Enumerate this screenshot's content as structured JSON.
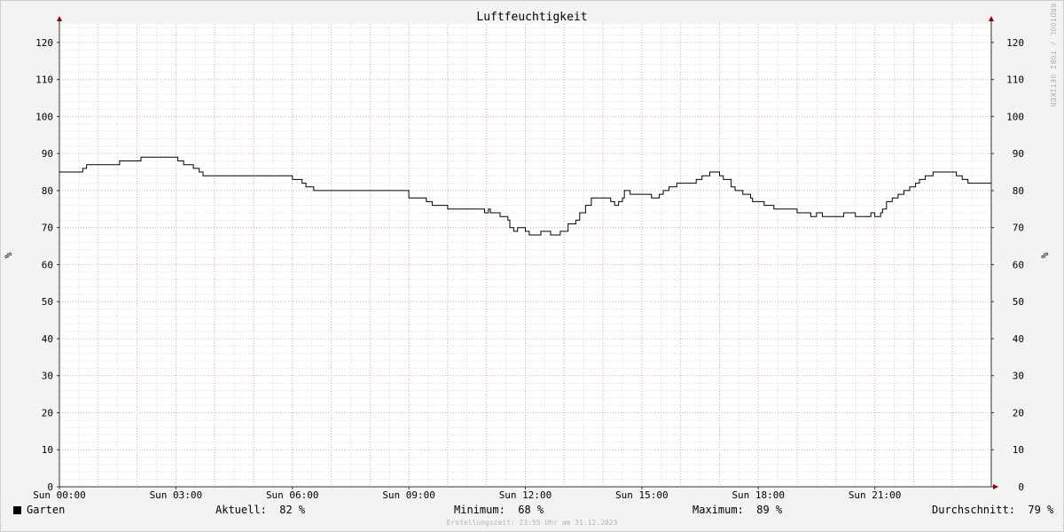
{
  "chart_data": {
    "type": "line",
    "title": "Luftfeuchtigkeit",
    "ylabel": "%",
    "ylim": [
      0,
      125
    ],
    "yticks": [
      0,
      10,
      20,
      30,
      40,
      50,
      60,
      70,
      80,
      90,
      100,
      110,
      120
    ],
    "xlim": [
      0,
      24
    ],
    "xticks": [
      {
        "hour": 0,
        "label": "Sun 00:00"
      },
      {
        "hour": 3,
        "label": "Sun 03:00"
      },
      {
        "hour": 6,
        "label": "Sun 06:00"
      },
      {
        "hour": 9,
        "label": "Sun 09:00"
      },
      {
        "hour": 12,
        "label": "Sun 12:00"
      },
      {
        "hour": 15,
        "label": "Sun 15:00"
      },
      {
        "hour": 18,
        "label": "Sun 18:00"
      },
      {
        "hour": 21,
        "label": "Sun 21:00"
      }
    ],
    "grid": true,
    "series": [
      {
        "name": "Garten",
        "color": "#000000",
        "x": [
          0,
          0.45,
          0.6,
          0.7,
          1.2,
          1.25,
          1.55,
          2.0,
          2.1,
          2.95,
          3.05,
          3.2,
          3.3,
          3.45,
          3.6,
          3.7,
          5.75,
          6.0,
          6.05,
          6.25,
          6.35,
          6.55,
          8.7,
          9.0,
          9.45,
          9.6,
          9.9,
          10.0,
          10.8,
          10.95,
          11.05,
          11.1,
          11.35,
          11.55,
          11.6,
          11.7,
          11.8,
          12.0,
          12.1,
          12.2,
          12.4,
          12.5,
          12.65,
          12.8,
          12.9,
          13.1,
          13.2,
          13.3,
          13.4,
          13.55,
          13.7,
          13.8,
          14.1,
          14.2,
          14.3,
          14.4,
          14.5,
          14.55,
          14.7,
          14.8,
          15.15,
          15.25,
          15.3,
          15.45,
          15.55,
          15.7,
          15.9,
          16.0,
          16.1,
          16.2,
          16.4,
          16.55,
          16.75,
          17.0,
          17.1,
          17.3,
          17.4,
          17.6,
          17.8,
          17.85,
          18.0,
          18.15,
          18.4,
          18.6,
          19.0,
          19.2,
          19.35,
          19.5,
          19.65,
          19.75,
          20.1,
          20.2,
          20.5,
          20.6,
          20.9,
          21.0,
          21.05,
          21.15,
          21.2,
          21.3,
          21.45,
          21.6,
          21.75,
          21.9,
          22.05,
          22.15,
          22.3,
          22.5,
          22.75,
          22.9,
          23.1,
          23.25,
          23.4,
          23.5,
          23.75,
          24.0
        ],
        "values": [
          85,
          85,
          86,
          87,
          87,
          87,
          88,
          88,
          89,
          89,
          88,
          87,
          87,
          86,
          85,
          84,
          84,
          83,
          83,
          82,
          81,
          80,
          80,
          78,
          77,
          76,
          76,
          75,
          75,
          74,
          75,
          74,
          73,
          72,
          70,
          69,
          70,
          69,
          68,
          68,
          69,
          69,
          68,
          68,
          69,
          71,
          71,
          72,
          74,
          76,
          78,
          78,
          78,
          77,
          76,
          77,
          78,
          80,
          79,
          79,
          79,
          78,
          78,
          79,
          80,
          81,
          82,
          82,
          82,
          82,
          83,
          84,
          85,
          84,
          83,
          81,
          80,
          79,
          78,
          77,
          77,
          76,
          75,
          75,
          74,
          74,
          73,
          74,
          73,
          73,
          73,
          74,
          73,
          73,
          74,
          73,
          73,
          74,
          75,
          77,
          78,
          79,
          80,
          81,
          82,
          83,
          84,
          85,
          85,
          85,
          84,
          83,
          82,
          82,
          82,
          82
        ]
      }
    ]
  },
  "legend": {
    "series_name": "Garten",
    "current_label": "Aktuell:",
    "current_value": "82 %",
    "min_label": "Minimum:",
    "min_value": "68 %",
    "max_label": "Maximum:",
    "max_value": "89 %",
    "avg_label": "Durchschnitt:",
    "avg_value": "79 %"
  },
  "footer": "Erstellungszeit: 23:55 Uhr am 31.12.2023",
  "watermark": "RRDTOOL / TOBI OETIKER",
  "colors": {
    "background": "#f3f3f3",
    "plot_background": "#ffffff",
    "major_grid": "#e6a0a0",
    "minor_grid": "#d8d8d8",
    "line": "#000000",
    "arrow": "#8b0000"
  }
}
